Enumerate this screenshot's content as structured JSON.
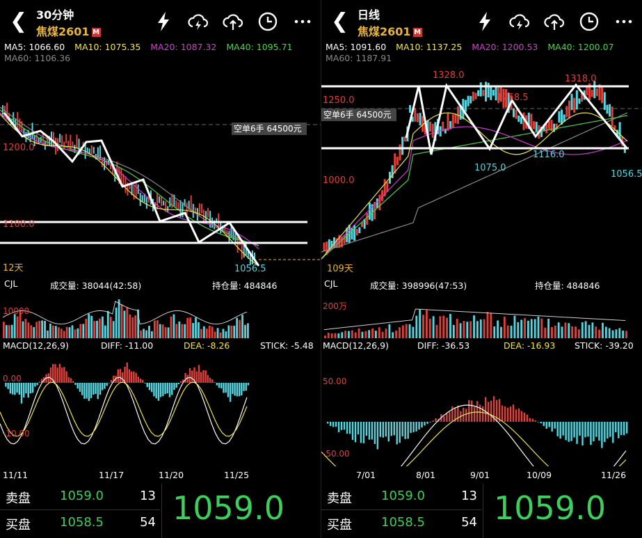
{
  "left": {
    "header": {
      "timeframe": "30分钟",
      "symbol": "焦煤2601",
      "badge": "M"
    },
    "ma": {
      "ma5": "MA5: 1066.60",
      "ma10": "MA10: 1075.35",
      "ma20": "MA20: 1087.32",
      "ma40": "MA40: 1095.71",
      "ma60": "MA60: 1106.36"
    },
    "price_axis": {
      "top": "1200.0",
      "mid": "1100.0"
    },
    "order_label": "空单6手 64500元",
    "last_price_label": "1056.5",
    "range_label": "12天",
    "volume": {
      "name": "CJL",
      "vol": "成交量: 38044(42:58)",
      "oi": "持仓量: 484846",
      "axis": "10000"
    },
    "macd": {
      "name": "MACD(12,26,9)",
      "diff": "DIFF: -11.00",
      "dea": "DEA: -8.26",
      "stick": "STICK: -5.48",
      "axis_top": "0.00",
      "axis_bot": "-10.00"
    },
    "dates": [
      "11/11",
      "11/17",
      "11/20",
      "11/25"
    ],
    "quote": {
      "sell_label": "卖盘",
      "sell_price": "1059.0",
      "sell_vol": "13",
      "buy_label": "买盘",
      "buy_price": "1058.5",
      "buy_vol": "54",
      "last": "1059.0"
    }
  },
  "right": {
    "header": {
      "timeframe": "日线",
      "symbol": "焦煤2601",
      "badge": "M"
    },
    "ma": {
      "ma5": "MA5: 1091.60",
      "ma10": "MA10: 1137.25",
      "ma20": "MA20: 1200.53",
      "ma40": "MA40: 1200.07",
      "ma60": "MA60: 1187.91"
    },
    "price_axis": {
      "top": "1250.0",
      "mid": "1000.0"
    },
    "order_label": "空单6手 64500元",
    "peaks": {
      "p1": "1328.0",
      "p2": "1258.5",
      "p3": "1318.0",
      "l1": "1075.0",
      "l2": "1116.0",
      "last": "1056.5"
    },
    "range_label": "109天",
    "volume": {
      "name": "CJL",
      "vol": "成交量: 398996(47:53)",
      "oi": "持仓量: 484846",
      "axis": "200万"
    },
    "macd": {
      "name": "MACD(12,26,9)",
      "diff": "DIFF: -36.53",
      "dea": "DEA: -16.93",
      "stick": "STICK: -39.20",
      "axis_top": "50.00",
      "axis_bot": "-50.00"
    },
    "dates": [
      "7/01",
      "8/01",
      "9/01",
      "10/09",
      "11/26"
    ],
    "quote": {
      "sell_label": "卖盘",
      "sell_price": "1059.0",
      "sell_vol": "13",
      "buy_label": "买盘",
      "buy_price": "1058.5",
      "buy_vol": "54",
      "last": "1059.0"
    }
  },
  "colors": {
    "ma5": "#ffffff",
    "ma10": "#f2e64a",
    "ma20": "#d43ad8",
    "ma40": "#4ad24a",
    "ma60": "#8a8a8a",
    "up": "#e0403a",
    "down": "#56d6e0",
    "price_label": "#e0403a",
    "date": "#ffffff"
  },
  "icons": [
    "back-icon",
    "lightning-icon",
    "cloud-lightning-icon",
    "cloud-upload-icon",
    "clock-icon",
    "more-icon"
  ]
}
